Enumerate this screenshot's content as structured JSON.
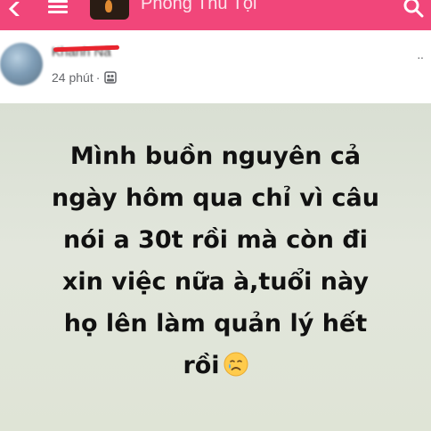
{
  "appbar": {
    "group_name": "Phong Thủ Tội",
    "background": "#f1467a",
    "icons": [
      "back-icon",
      "menu-icon",
      "search-icon"
    ]
  },
  "post": {
    "author": "Khanh Nà",
    "time": "24 phút",
    "separator": "·",
    "privacy_icon": "group-members-icon",
    "more": "··",
    "text_lines": [
      "Mình buồn nguyên cả",
      "ngày hôm qua chỉ vì câu",
      "nói a 30t rồi mà còn đi",
      "xin việc nữa à,tuổi này",
      "họ lên làm quản lý hết",
      "rồi"
    ],
    "emoji": "sad-tear-emoji"
  }
}
